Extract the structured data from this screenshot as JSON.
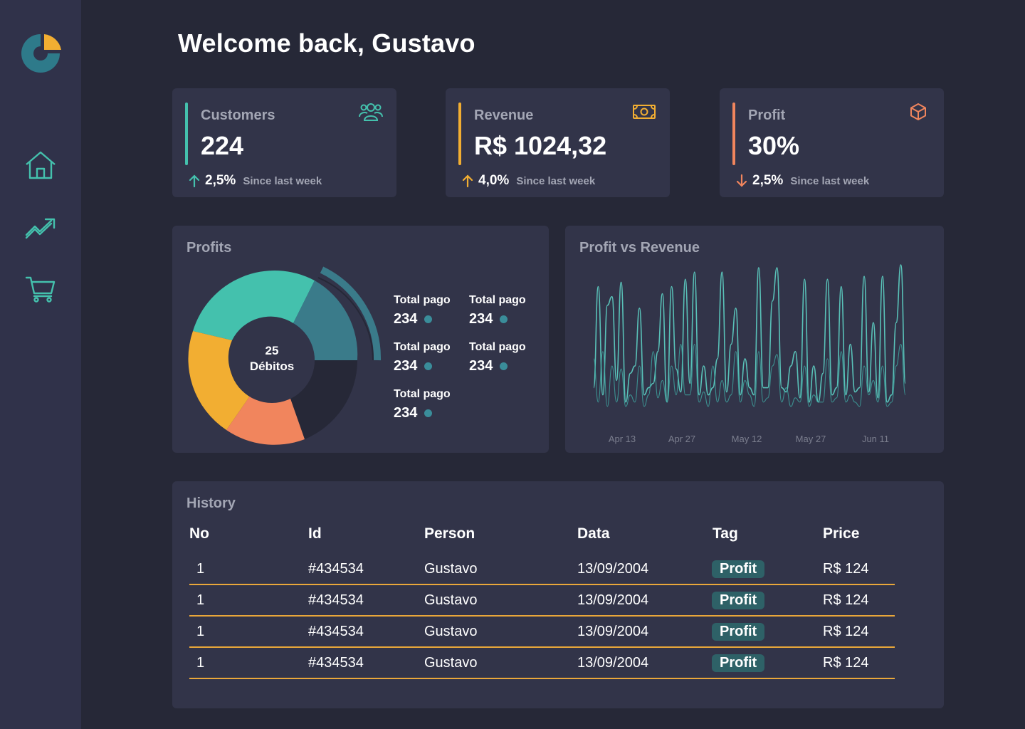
{
  "page_title": "Welcome back, Gustavo",
  "colors": {
    "background": "#262837",
    "sidebar": "#30324a",
    "card": "#323449",
    "teal": "#44c1ad",
    "dark_teal": "#3a7b8a",
    "orange": "#f2ae32",
    "salmon": "#f1855d",
    "divider": "#e9a73a"
  },
  "sidebar": {
    "items": [
      {
        "icon": "home-icon"
      },
      {
        "icon": "trending-up-icon"
      },
      {
        "icon": "cart-icon"
      }
    ]
  },
  "stats": [
    {
      "label": "Customers",
      "value": "224",
      "change": "2,5%",
      "direction": "up",
      "since": "Since last week",
      "accent": "#44c1ad",
      "icon": "users-icon"
    },
    {
      "label": "Revenue",
      "value": "R$ 1024,32",
      "change": "4,0%",
      "direction": "up",
      "since": "Since last week",
      "accent": "#f2ae32",
      "icon": "money-icon"
    },
    {
      "label": "Profit",
      "value": "30%",
      "change": "2,5%",
      "direction": "down",
      "since": "Since last week",
      "accent": "#f1855d",
      "icon": "box-icon"
    }
  ],
  "profits": {
    "title": "Profits",
    "center_value": "25",
    "center_label": "Débitos",
    "legend": [
      {
        "label": "Total pago",
        "value": "234"
      },
      {
        "label": "Total pago",
        "value": "234"
      },
      {
        "label": "Total pago",
        "value": "234"
      },
      {
        "label": "Total pago",
        "value": "234"
      },
      {
        "label": "Total pago",
        "value": "234"
      }
    ]
  },
  "chart_data": {
    "type": "pie",
    "variant": "donut",
    "title": "Profits",
    "slices": [
      {
        "value": 0.25,
        "color": "#44c1ad"
      },
      {
        "value": 0.15,
        "color": "#3a7b8a"
      },
      {
        "value": 0.25,
        "color": "#262837"
      },
      {
        "value": 0.15,
        "color": "#f1855d"
      },
      {
        "value": 0.2,
        "color": "#f2ae32"
      }
    ]
  },
  "profit_vs_revenue": {
    "title": "Profit vs Revenue",
    "x_ticks": [
      "Apr 13",
      "Apr 27",
      "May 12",
      "May 27",
      "Jun 11"
    ],
    "chart": {
      "type": "line",
      "series": [
        {
          "values": [
            0.15,
            0.85,
            0.1,
            0.72,
            0.78,
            0.2,
            0.88,
            0.05,
            0.25,
            0.3,
            0.7,
            0.1,
            0.15,
            0.18,
            0.4,
            0.8,
            0.05,
            0.85,
            0.28,
            0.12,
            0.9,
            0.18,
            0.95,
            0.1,
            0.3,
            0.1,
            0.15,
            0.35,
            0.95,
            0.12,
            0.45,
            0.7,
            0.1,
            0.35,
            0.15,
            0.1,
            0.98,
            0.15,
            0.15,
            0.75,
            0.98,
            0.15,
            0.12,
            0.3,
            0.4,
            0.08,
            0.9,
            0.05,
            0.3,
            0.05,
            0.25,
            0.9,
            0.1,
            0.15,
            0.85,
            0.1,
            0.45,
            0.12,
            0.15,
            0.92,
            0.12,
            0.6,
            0.08,
            0.92,
            0.05,
            0.1,
            0.6,
            1.0,
            0.18
          ],
          "color": "#5cc9bf"
        },
        {
          "values": [
            0.35,
            0.05,
            0.4,
            0.02,
            0.3,
            0.05,
            0.28,
            0.02,
            0.1,
            0.05,
            0.3,
            0.02,
            0.1,
            0.4,
            0.08,
            0.2,
            0.05,
            0.3,
            0.1,
            0.45,
            0.1,
            0.1,
            0.45,
            0.05,
            0.12,
            0.02,
            0.3,
            0.05,
            0.2,
            0.05,
            0.1,
            0.4,
            0.05,
            0.2,
            0.1,
            0.02,
            0.4,
            0.05,
            0.08,
            0.3,
            0.38,
            0.05,
            0.15,
            0.02,
            0.08,
            0.05,
            0.3,
            0.02,
            0.1,
            0.05,
            0.05,
            0.35,
            0.05,
            0.08,
            0.4,
            0.05,
            0.1,
            0.05,
            0.02,
            0.3,
            0.1,
            0.2,
            0.05,
            0.3,
            0.02,
            0.05,
            0.3,
            0.45,
            0.1
          ],
          "color": "#3fa7a2"
        }
      ]
    }
  },
  "history": {
    "title": "History",
    "columns": [
      "No",
      "Id",
      "Person",
      "Data",
      "Tag",
      "Price"
    ],
    "rows": [
      {
        "no": "1",
        "id": "#434534",
        "person": "Gustavo",
        "date": "13/09/2004",
        "tag": "Profit",
        "price": "R$ 124"
      },
      {
        "no": "1",
        "id": "#434534",
        "person": "Gustavo",
        "date": "13/09/2004",
        "tag": "Profit",
        "price": "R$ 124"
      },
      {
        "no": "1",
        "id": "#434534",
        "person": "Gustavo",
        "date": "13/09/2004",
        "tag": "Profit",
        "price": "R$ 124"
      },
      {
        "no": "1",
        "id": "#434534",
        "person": "Gustavo",
        "date": "13/09/2004",
        "tag": "Profit",
        "price": "R$ 124"
      }
    ]
  }
}
